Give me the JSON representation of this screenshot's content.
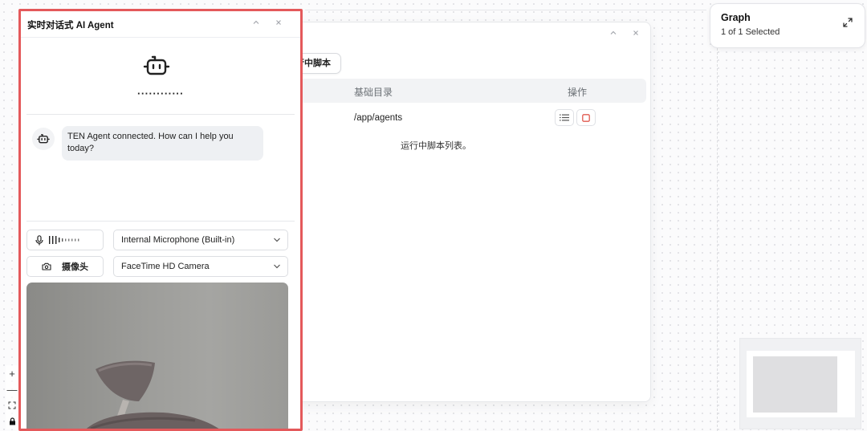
{
  "graph_panel": {
    "title": "Graph",
    "selection_text": "1 of 1 Selected"
  },
  "flow_controls": [
    "+",
    "—"
  ],
  "scripts_window": {
    "tab_label": "行中脚本",
    "columns": {
      "directory": "基础目录",
      "actions": "操作"
    },
    "rows": [
      {
        "directory": "/app/agents"
      }
    ],
    "caption": "运行中脚本列表。"
  },
  "agent_panel": {
    "title": "实时对话式 AI Agent",
    "typing_indicator": "············",
    "messages": [
      {
        "sender": "agent",
        "text": "TEN Agent connected. How can I help you today?"
      }
    ],
    "microphone": {
      "selected": "Internal Microphone (Built-in)"
    },
    "camera": {
      "button_label": "摄像头",
      "selected": "FaceTime HD Camera"
    }
  },
  "colors": {
    "panel_border": "#e4595b",
    "stop_button": "#e05a4f",
    "bubble_bg": "#eef0f3"
  },
  "icons": [
    "expand-icon",
    "collapse-icon",
    "close-icon",
    "robot-icon",
    "microphone-icon",
    "camera-icon",
    "chevron-down-icon",
    "list-icon",
    "stop-icon",
    "fit-view-icon",
    "lock-icon"
  ]
}
